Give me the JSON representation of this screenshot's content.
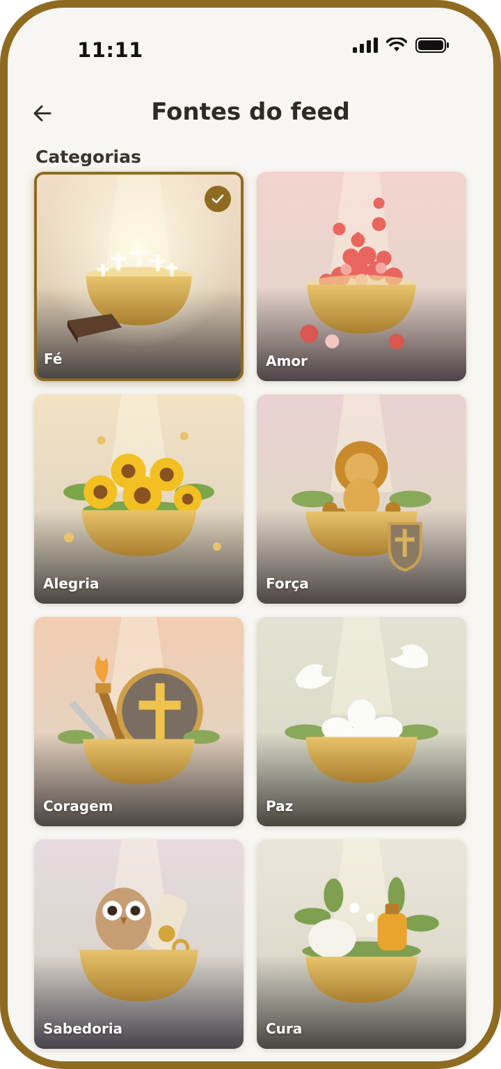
{
  "status_bar": {
    "time": "11:11",
    "icons": [
      "signal-icon",
      "wifi-icon",
      "battery-icon"
    ]
  },
  "header": {
    "back_icon": "arrow-left-icon",
    "title": "Fontes do feed"
  },
  "section": {
    "label": "Categorias"
  },
  "categories": [
    {
      "label": "Fé",
      "selected": true,
      "icon": "bowl-of-crosses-with-bible"
    },
    {
      "label": "Amor",
      "selected": false,
      "icon": "bowl-of-hearts"
    },
    {
      "label": "Alegria",
      "selected": false,
      "icon": "bowl-of-sunflowers"
    },
    {
      "label": "Força",
      "selected": false,
      "icon": "lion-in-bowl-with-shield"
    },
    {
      "label": "Coragem",
      "selected": false,
      "icon": "torch-sword-shield-in-bowl"
    },
    {
      "label": "Paz",
      "selected": false,
      "icon": "doves-in-bowl"
    },
    {
      "label": "Sabedoria",
      "selected": false,
      "icon": "owl-scroll-key-in-bowl"
    },
    {
      "label": "Cura",
      "selected": false,
      "icon": "bandage-oil-herbs-in-bowl"
    }
  ],
  "colors": {
    "accent": "#8f6a21",
    "background": "#f8f6f2",
    "title": "#2e2a27"
  },
  "check_icon": "checkmark-icon"
}
